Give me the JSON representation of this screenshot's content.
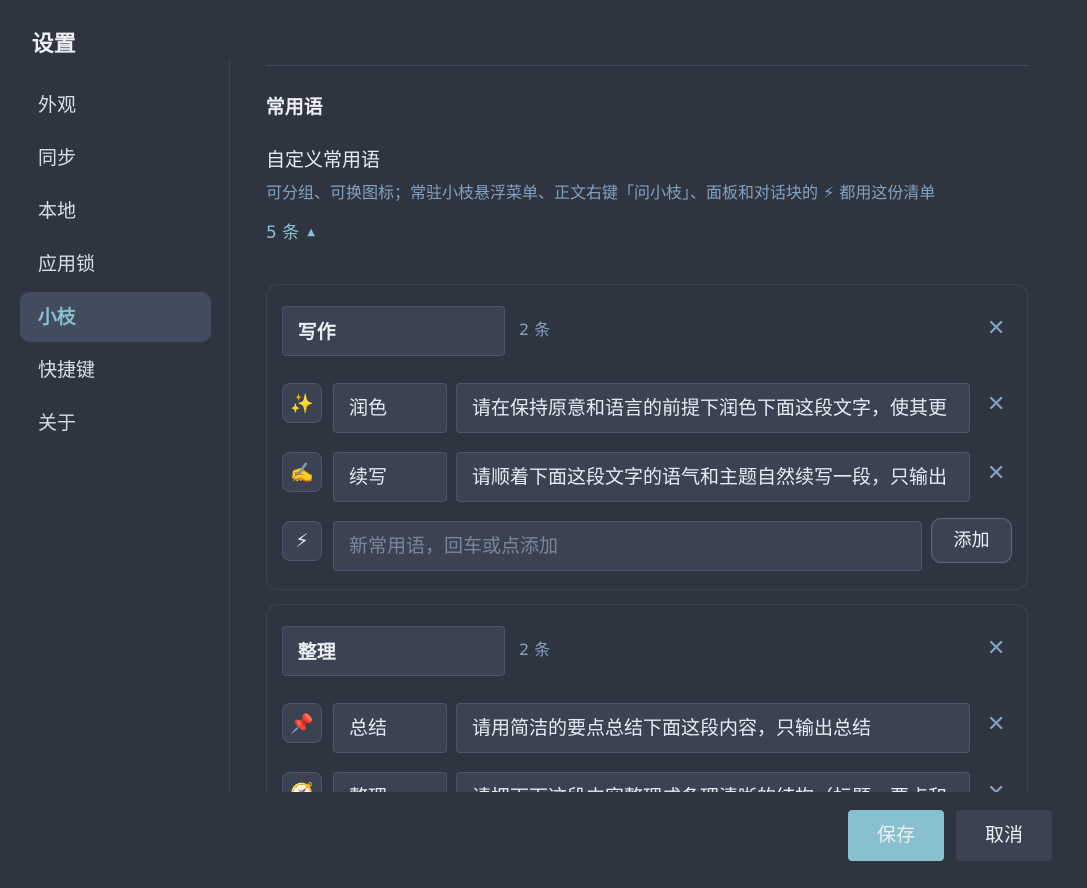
{
  "dialog": {
    "title": "设置"
  },
  "sidebar": {
    "items": [
      {
        "label": "外观"
      },
      {
        "label": "同步"
      },
      {
        "label": "本地"
      },
      {
        "label": "应用锁"
      },
      {
        "label": "小枝",
        "active": true
      },
      {
        "label": "快捷键"
      },
      {
        "label": "关于"
      }
    ]
  },
  "section": {
    "title": "常用语",
    "subtitle": "自定义常用语",
    "description": "可分组、可换图标；常驻小枝悬浮菜单、正文右键「问小枝」、面板和对话块的 ⚡ 都用这份清单",
    "count_label": "5 条",
    "count_arrow": "▲"
  },
  "groups": [
    {
      "name": "写作",
      "count": "2 条",
      "close": "✕",
      "items": [
        {
          "icon": "✨",
          "name": "润色",
          "prompt": "请在保持原意和语言的前提下润色下面这段文字，使其更",
          "close": "✕"
        },
        {
          "icon": "✍️",
          "name": "续写",
          "prompt": "请顺着下面这段文字的语气和主题自然续写一段，只输出",
          "close": "✕"
        }
      ],
      "new_item": {
        "icon": "⚡",
        "placeholder": "新常用语，回车或点添加",
        "add_label": "添加"
      }
    },
    {
      "name": "整理",
      "count": "2 条",
      "close": "✕",
      "items": [
        {
          "icon": "📌",
          "name": "总结",
          "prompt": "请用简洁的要点总结下面这段内容，只输出总结",
          "close": "✕"
        },
        {
          "icon": "🧭",
          "name": "整理",
          "prompt": "请把下面这段内容整理成条理清晰的结构（标题、要点和",
          "close": "✕"
        }
      ]
    }
  ],
  "footer": {
    "save_label": "保存",
    "cancel_label": "取消"
  },
  "colors": {
    "accent": "#88c0d0",
    "background": "#2e3440",
    "panel": "#3b4252"
  }
}
